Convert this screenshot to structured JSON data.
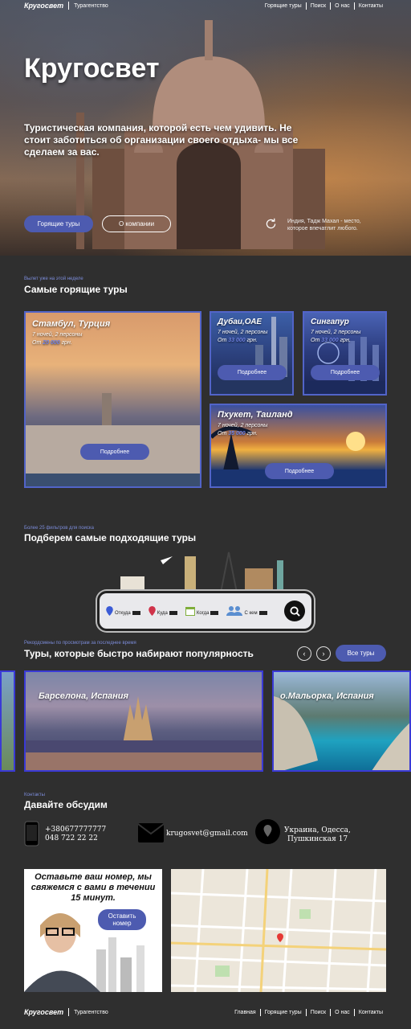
{
  "header": {
    "brand": "Кругосвет",
    "brand_sub": "Турагентство",
    "nav": [
      "Горящие туры",
      "Поиск",
      "О нас",
      "Контакты"
    ]
  },
  "hero": {
    "title": "Кругосвет",
    "text": "Туристическая компания, которой есть чем удивить. Не стоит заботиться об организации своего отдыха- мы все сделаем за вас.",
    "btn_hot": "Горящие туры",
    "btn_about": "О компании",
    "caption": "Индия, Тадж Махал - место, которое впечатлит любого."
  },
  "hot": {
    "kicker": "Вылет уже на этой неделе",
    "title": "Самые горящие туры",
    "cards": [
      {
        "title": "Стамбул, Турция",
        "line1": "7 ночей, 2 персоны",
        "from": "От",
        "price": "20 000",
        "currency": "грн.",
        "button": "Подробнее"
      },
      {
        "title": "Дубаи,ОАЕ",
        "line1": "7 ночей, 2 персоны",
        "from": "От",
        "price": "33 000",
        "currency": "грн.",
        "button": "Подробнее"
      },
      {
        "title": "Сингапур",
        "line1": "7 ночей, 2 персоны",
        "from": "От",
        "price": "33 000",
        "currency": "грн.",
        "button": "Подробнее"
      },
      {
        "title": "Пхукет, Таиланд",
        "line1": "7 ночей, 2 персоны",
        "from": "От",
        "price": "35 000",
        "currency": "грн.",
        "button": "Подробнее"
      }
    ]
  },
  "filter": {
    "kicker": "Более 25 фильтров для поиска",
    "title": "Подберем самые подходящие туры",
    "fields": [
      "Откуда",
      "Куда",
      "Когда",
      "С кем"
    ]
  },
  "popular": {
    "kicker": "Рекордсмены по просмотрам за последнее время",
    "title": "Туры, которые быстро набирают популярность",
    "all_button": "Все туры",
    "prev": "‹",
    "next": "›",
    "cards": [
      "Барселона, Испания",
      "о.Мальорка, Испания"
    ]
  },
  "contacts": {
    "kicker": "Контакты",
    "title": "Давайте обсудим",
    "phone1": "+380677777777",
    "phone2": "048 722 22 22",
    "email": "krugosvet@gmail.com",
    "address1": "Украина, Одесса,",
    "address2": "Пушкинская 17",
    "callback_text": "Оставьте ваш номер, мы свяжемся с вами в течении 15 минут.",
    "callback_button": "Оставить номер"
  },
  "footer": {
    "brand": "Кругосвет",
    "brand_sub": "Турагентство",
    "nav": [
      "Главная",
      "Горящие туры",
      "Поиск",
      "О нас",
      "Контакты"
    ]
  }
}
